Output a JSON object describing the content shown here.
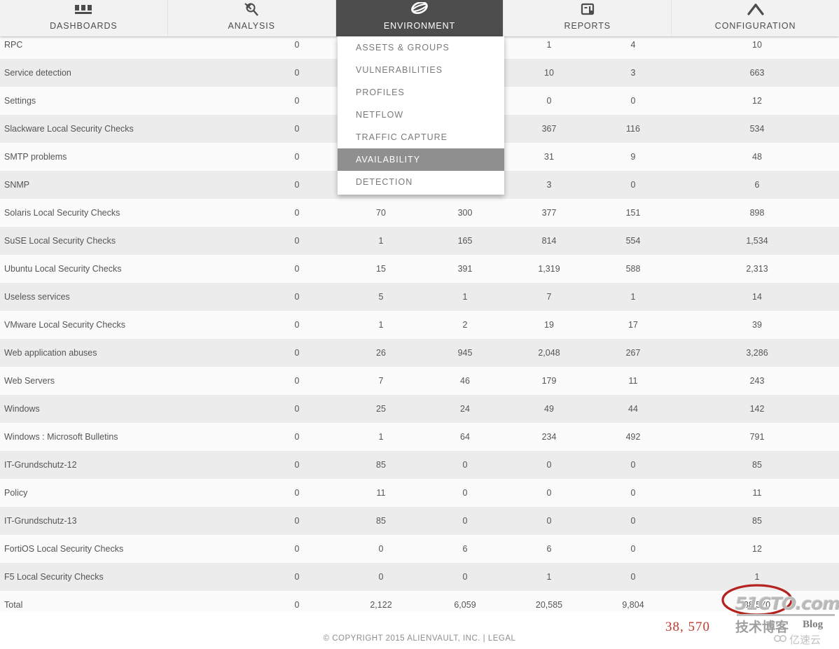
{
  "navbar": {
    "tabs": [
      {
        "label": "DASHBOARDS",
        "icon": "dashboard-icon",
        "active": false
      },
      {
        "label": "ANALYSIS",
        "icon": "magnifier-icon",
        "active": false
      },
      {
        "label": "ENVIRONMENT",
        "icon": "globe-icon",
        "active": true
      },
      {
        "label": "REPORTS",
        "icon": "report-icon",
        "active": false
      },
      {
        "label": "CONFIGURATION",
        "icon": "wrench-icon",
        "active": false
      }
    ]
  },
  "dropdown": {
    "items": [
      {
        "label": "ASSETS & GROUPS",
        "selected": false
      },
      {
        "label": "VULNERABILITIES",
        "selected": false
      },
      {
        "label": "PROFILES",
        "selected": false
      },
      {
        "label": "NETFLOW",
        "selected": false
      },
      {
        "label": "TRAFFIC CAPTURE",
        "selected": false
      },
      {
        "label": "AVAILABILITY",
        "selected": true
      },
      {
        "label": "DETECTION",
        "selected": false
      }
    ]
  },
  "table": {
    "rows": [
      {
        "name": "RPC",
        "values": [
          "0",
          "",
          "",
          "1",
          "4",
          "10"
        ]
      },
      {
        "name": "Service detection",
        "values": [
          "0",
          "",
          "",
          "10",
          "3",
          "663"
        ]
      },
      {
        "name": "Settings",
        "values": [
          "0",
          "",
          "",
          "0",
          "0",
          "12"
        ]
      },
      {
        "name": "Slackware Local Security Checks",
        "values": [
          "0",
          "",
          "",
          "367",
          "116",
          "534"
        ]
      },
      {
        "name": "SMTP problems",
        "values": [
          "0",
          "",
          "",
          "31",
          "9",
          "48"
        ]
      },
      {
        "name": "SNMP",
        "values": [
          "0",
          "",
          "",
          "3",
          "0",
          "6"
        ]
      },
      {
        "name": "Solaris Local Security Checks",
        "values": [
          "0",
          "70",
          "300",
          "377",
          "151",
          "898"
        ]
      },
      {
        "name": "SuSE Local Security Checks",
        "values": [
          "0",
          "1",
          "165",
          "814",
          "554",
          "1,534"
        ]
      },
      {
        "name": "Ubuntu Local Security Checks",
        "values": [
          "0",
          "15",
          "391",
          "1,319",
          "588",
          "2,313"
        ]
      },
      {
        "name": "Useless services",
        "values": [
          "0",
          "5",
          "1",
          "7",
          "1",
          "14"
        ]
      },
      {
        "name": "VMware Local Security Checks",
        "values": [
          "0",
          "1",
          "2",
          "19",
          "17",
          "39"
        ]
      },
      {
        "name": "Web application abuses",
        "values": [
          "0",
          "26",
          "945",
          "2,048",
          "267",
          "3,286"
        ]
      },
      {
        "name": "Web Servers",
        "values": [
          "0",
          "7",
          "46",
          "179",
          "11",
          "243"
        ]
      },
      {
        "name": "Windows",
        "values": [
          "0",
          "25",
          "24",
          "49",
          "44",
          "142"
        ]
      },
      {
        "name": "Windows : Microsoft Bulletins",
        "values": [
          "0",
          "1",
          "64",
          "234",
          "492",
          "791"
        ]
      },
      {
        "name": "IT-Grundschutz-12",
        "values": [
          "0",
          "85",
          "0",
          "0",
          "0",
          "85"
        ]
      },
      {
        "name": "Policy",
        "values": [
          "0",
          "11",
          "0",
          "0",
          "0",
          "11"
        ]
      },
      {
        "name": "IT-Grundschutz-13",
        "values": [
          "0",
          "85",
          "0",
          "0",
          "0",
          "85"
        ]
      },
      {
        "name": "FortiOS Local Security Checks",
        "values": [
          "0",
          "0",
          "6",
          "6",
          "0",
          "12"
        ]
      },
      {
        "name": "F5 Local Security Checks",
        "values": [
          "0",
          "0",
          "0",
          "1",
          "0",
          "1"
        ]
      },
      {
        "name": "Total",
        "values": [
          "0",
          "2,122",
          "6,059",
          "20,585",
          "9,804",
          "38,570"
        ]
      }
    ]
  },
  "footer": {
    "copyright": "© COPYRIGHT 2015 ALIENVAULT, INC.  |  ",
    "legal": "LEGAL"
  },
  "annotations": {
    "circled_total": "38, 570",
    "accent_color": "#c0392b"
  },
  "watermark": {
    "site": "51CTO.com",
    "chinese": "技术博客",
    "blog": "Blog",
    "cloud": "亿速云"
  }
}
